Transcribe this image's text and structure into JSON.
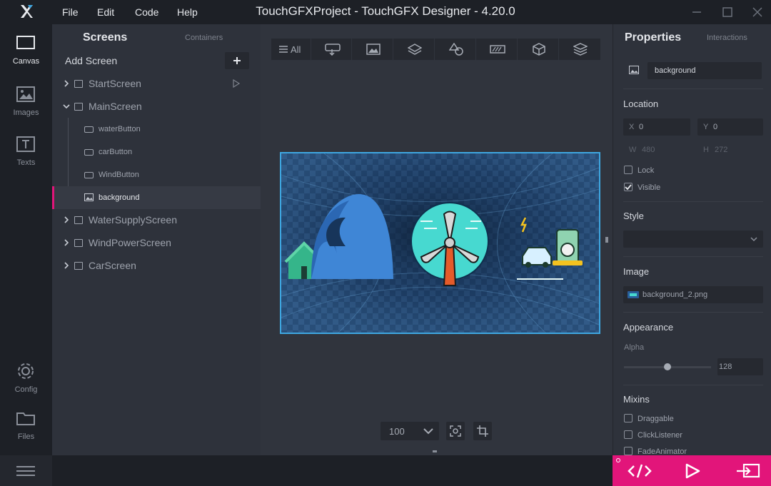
{
  "app": {
    "title": "TouchGFXProject - TouchGFX Designer - 4.20.0"
  },
  "menu": [
    "File",
    "Edit",
    "Code",
    "Help"
  ],
  "nav": [
    {
      "label": "Canvas",
      "icon": "canvas-icon"
    },
    {
      "label": "Images",
      "icon": "images-icon"
    },
    {
      "label": "Texts",
      "icon": "texts-icon"
    },
    {
      "label": "Config",
      "icon": "gear-icon"
    },
    {
      "label": "Files",
      "icon": "folder-icon"
    }
  ],
  "tree": {
    "tab_screens": "Screens",
    "tab_containers": "Containers",
    "add_screen": "Add Screen",
    "screens": [
      "StartScreen",
      "MainScreen",
      "WaterSupplyScreen",
      "WindPowerScreen",
      "CarScreen"
    ],
    "widgets": [
      "waterButton",
      "carButton",
      "WindButton",
      "background"
    ]
  },
  "toolbar": {
    "all_label": "All"
  },
  "zoom": {
    "value": "100"
  },
  "properties": {
    "tab_properties": "Properties",
    "tab_interactions": "Interactions",
    "name": "background",
    "location_title": "Location",
    "x_label": "X",
    "x_value": "0",
    "y_label": "Y",
    "y_value": "0",
    "w_label": "W",
    "w_value": "480",
    "h_label": "H",
    "h_value": "272",
    "lock_label": "Lock",
    "visible_label": "Visible",
    "style_title": "Style",
    "image_title": "Image",
    "image_file": "background_2.png",
    "appearance_title": "Appearance",
    "alpha_label": "Alpha",
    "alpha_value": "128",
    "alpha_fraction": 0.5,
    "mixins_title": "Mixins",
    "mixins": [
      "Draggable",
      "ClickListener",
      "FadeAnimator"
    ]
  },
  "colors": {
    "accent": "#e2157a",
    "selection": "#3ea6e0"
  }
}
